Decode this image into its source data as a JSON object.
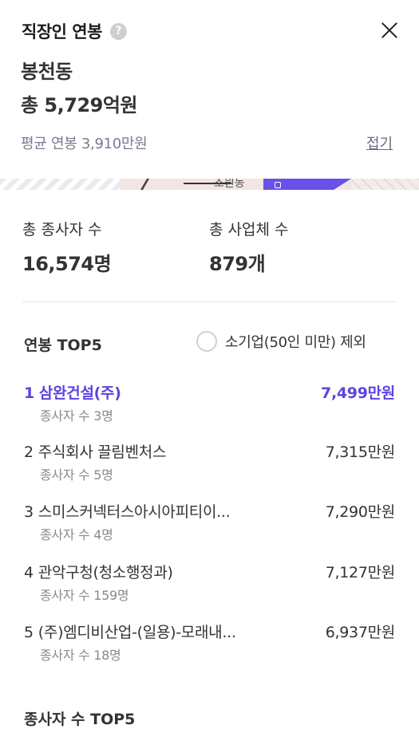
{
  "header": {
    "title": "직장인 연봉",
    "help_icon": "?",
    "close_icon": "close-icon",
    "region": "봉천동",
    "total": "총 5,729억원",
    "average": "평균 연봉 3,910만원",
    "fold_label": "접기"
  },
  "map": {
    "label": "조원동",
    "polygon_color": "#6a50e6"
  },
  "stats": {
    "employees_label": "총 종사자 수",
    "employees_value": "16,574명",
    "businesses_label": "총 사업체 수",
    "businesses_value": "879개"
  },
  "top5": {
    "title": "연봉 TOP5",
    "exclude_toggle_label": "소기업(50인 미만) 제외",
    "accent": "#5a45e0",
    "items": [
      {
        "rank": "1",
        "name": "삼완건설(주)",
        "salary": "7,499만원",
        "employees": "종사자 수 3명"
      },
      {
        "rank": "2",
        "name": "주식회사 끌림벤처스",
        "salary": "7,315만원",
        "employees": "종사자 수 5명"
      },
      {
        "rank": "3",
        "name": "스미스커넥터스아시아피티이...",
        "salary": "7,290만원",
        "employees": "종사자 수 4명"
      },
      {
        "rank": "4",
        "name": "관악구청(청소행정과)",
        "salary": "7,127만원",
        "employees": "종사자 수 159명"
      },
      {
        "rank": "5",
        "name": "(주)엠디비산업-(일용)-모래내...",
        "salary": "6,937만원",
        "employees": "종사자 수 18명"
      }
    ]
  },
  "employee_top5": {
    "title": "종사자 수 TOP5"
  }
}
